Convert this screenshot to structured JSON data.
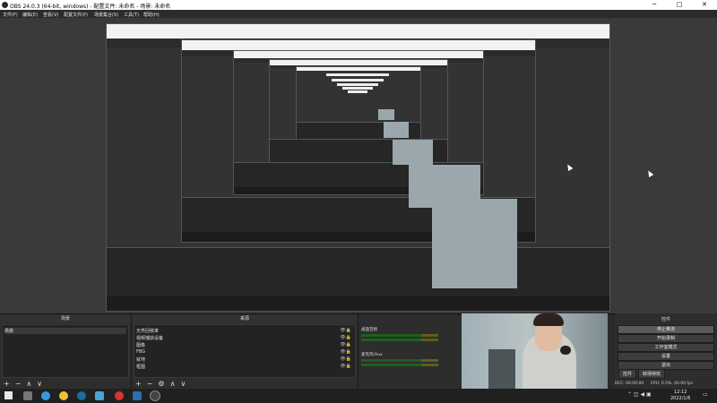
{
  "window": {
    "title": "OBS 24.0.3 (64-bit, windows) - 配置文件: 未命名 - 场景: 未命名",
    "minimize_glyph": "─",
    "maximize_glyph": "□",
    "close_glyph": "✕"
  },
  "menu": {
    "items": [
      "文件(F)",
      "编辑(E)",
      "查看(V)",
      "配置文件(P)",
      "场景集合(S)",
      "工具(T)",
      "帮助(H)"
    ]
  },
  "scenes": {
    "title": "场景",
    "items": [
      "场景"
    ],
    "add": "+",
    "remove": "−",
    "up": "∧",
    "down": "∨"
  },
  "sources": {
    "title": "来源",
    "items": [
      "无界回核率",
      "视频捕获设备",
      "图像",
      "FBG",
      "就地",
      "框图"
    ],
    "add": "+",
    "remove": "−",
    "settings": "⚙",
    "up": "∧",
    "down": "∨",
    "eye_lock": "👁🔒"
  },
  "mixer": {
    "channels": [
      {
        "label": "桌面音频",
        "level": 0.78
      },
      {
        "label": "麦克风/Aux",
        "level": 0.78
      }
    ]
  },
  "controls": {
    "title": "控件",
    "buttons": [
      "停止推流",
      "开始录制",
      "工作室模式",
      "设置",
      "退出"
    ],
    "tabs": [
      "控件",
      "转场特效"
    ]
  },
  "status": {
    "rec": "REC: 00:00:00",
    "cpu": "CPU: 0.5%, 60.00 fps"
  },
  "taskbar": {
    "time": "12:12",
    "date": "2022/1/6"
  },
  "colors": {
    "accent": "#5a5a5a",
    "meter_green": "#1f5e1f",
    "meter_yellow": "#5e5e1f"
  }
}
